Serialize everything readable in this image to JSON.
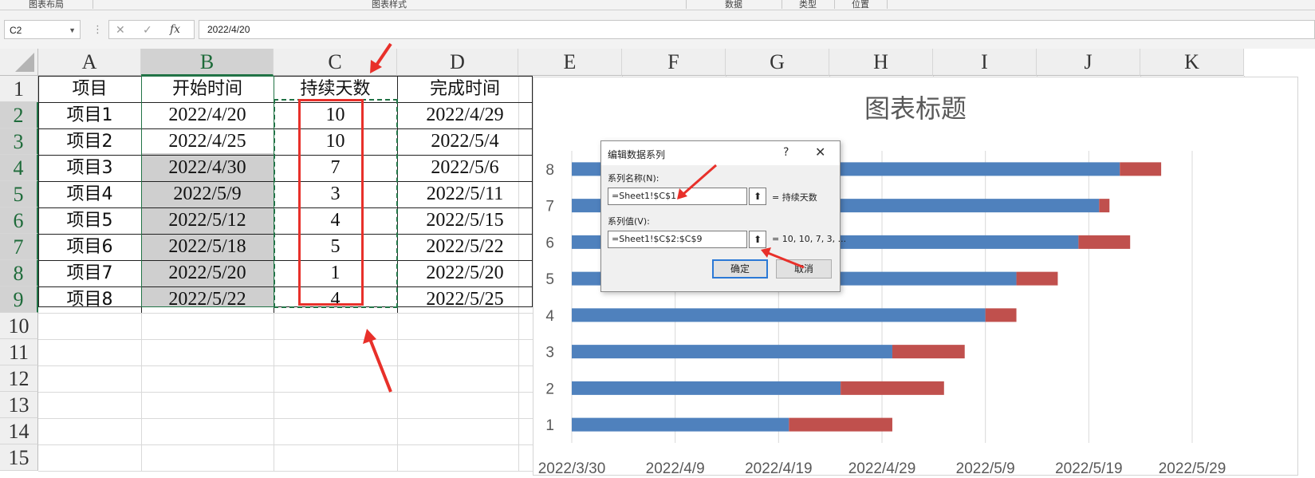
{
  "ribbon": {
    "groups": [
      "图表布局",
      "图表样式",
      "数据",
      "类型",
      "位置"
    ]
  },
  "formula_bar": {
    "name_box": "C2",
    "cancel_icon": "✕",
    "enter_icon": "✓",
    "fx_label": "fx",
    "formula": "2022/4/20"
  },
  "sheet": {
    "columns": [
      "A",
      "B",
      "C",
      "D",
      "E",
      "F",
      "G",
      "H",
      "I",
      "J",
      "K"
    ],
    "rows": [
      "1",
      "2",
      "3",
      "4",
      "5",
      "6",
      "7",
      "8",
      "9",
      "10",
      "11",
      "12",
      "13",
      "14",
      "15"
    ],
    "headers": [
      "项目",
      "开始时间",
      "持续天数",
      "完成时间"
    ],
    "table": [
      [
        "项目1",
        "2022/4/20",
        "10",
        "2022/4/29"
      ],
      [
        "项目2",
        "2022/4/25",
        "10",
        "2022/5/4"
      ],
      [
        "项目3",
        "2022/4/30",
        "7",
        "2022/5/6"
      ],
      [
        "项目4",
        "2022/5/9",
        "3",
        "2022/5/11"
      ],
      [
        "项目5",
        "2022/5/12",
        "4",
        "2022/5/15"
      ],
      [
        "项目6",
        "2022/5/18",
        "5",
        "2022/5/22"
      ],
      [
        "项目7",
        "2022/5/20",
        "1",
        "2022/5/20"
      ],
      [
        "项目8",
        "2022/5/22",
        "4",
        "2022/5/25"
      ]
    ]
  },
  "chart_data": {
    "type": "bar",
    "title": "图表标题",
    "orientation": "horizontal-stacked",
    "categories": [
      "1",
      "2",
      "3",
      "4",
      "5",
      "6",
      "7",
      "8"
    ],
    "series": [
      {
        "values": [
          "2022/4/20",
          "2022/4/25",
          "2022/4/30",
          "2022/5/9",
          "2022/5/12",
          "2022/5/18",
          "2022/5/20",
          "2022/5/22"
        ],
        "color": "#4f81bd"
      },
      {
        "values": [
          10,
          10,
          7,
          3,
          4,
          5,
          1,
          4
        ],
        "color": "#c0504d"
      }
    ],
    "x_tick_labels": [
      "2022/3/30",
      "2022/4/9",
      "2022/4/19",
      "2022/4/29",
      "2022/5/9",
      "2022/5/19",
      "2022/5/29"
    ],
    "xlim": [
      "2022/3/30",
      "2022/5/29"
    ],
    "grid": true
  },
  "dialog": {
    "title": "编辑数据系列",
    "help": "?",
    "close": "✕",
    "series_name_label": "系列名称(N):",
    "series_name_value": "=Sheet1!$C$1",
    "series_name_result": "= 持续天数",
    "series_values_label": "系列值(V):",
    "series_values_value": "=Sheet1!$C$2:$C$9",
    "series_values_result": "= 10, 10, 7, 3, ...",
    "ok": "确定",
    "cancel": "取消"
  },
  "colors": {
    "accent": "#217346",
    "highlight": "#e8302a",
    "bar_start": "#4f81bd",
    "bar_duration": "#c0504d"
  }
}
